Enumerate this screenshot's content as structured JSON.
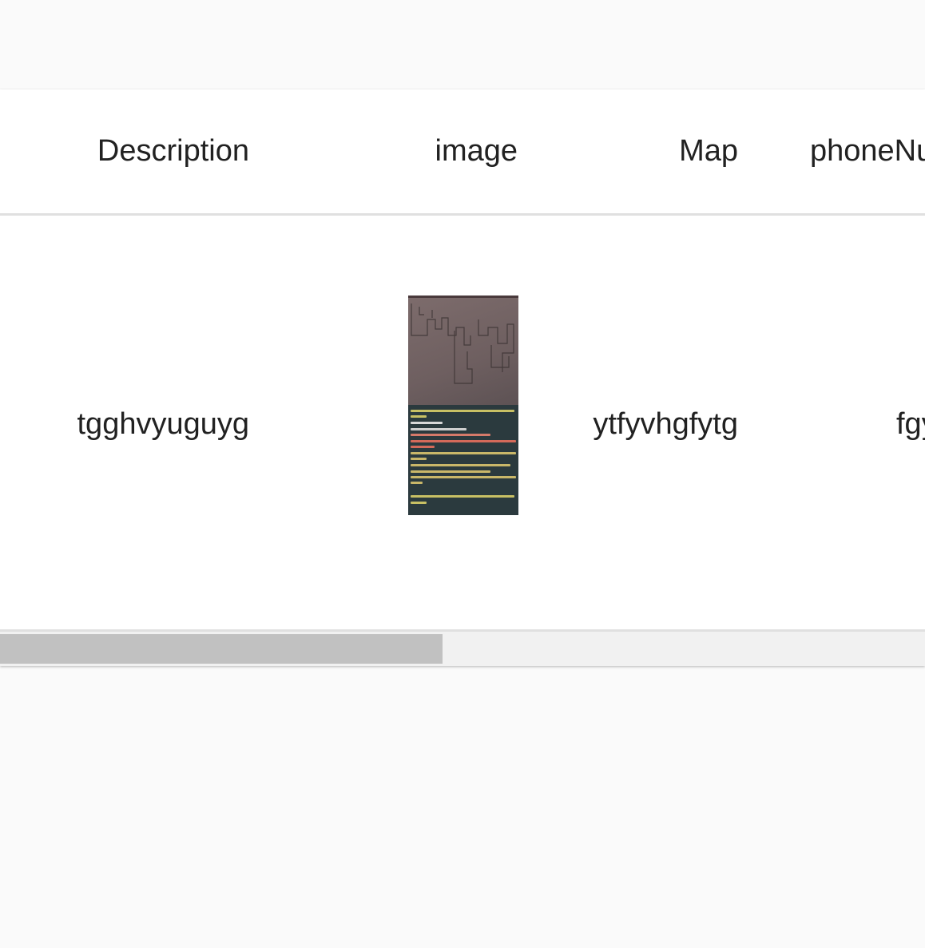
{
  "table": {
    "columns": {
      "description": "Description",
      "image": "image",
      "map": "Map",
      "phone": "phoneNu"
    },
    "rows": [
      {
        "description": "tgghvyuguyg",
        "image_icon": "photo-thumbnail",
        "map": "ytfyvhgfytg",
        "phone": "fgy"
      }
    ]
  },
  "colors": {
    "card_background": "#ffffff",
    "page_background": "#fafafa",
    "divider": "#e0e0e0",
    "scrollbar_track": "#f1f1f1",
    "scrollbar_thumb": "#c1c1c1"
  }
}
